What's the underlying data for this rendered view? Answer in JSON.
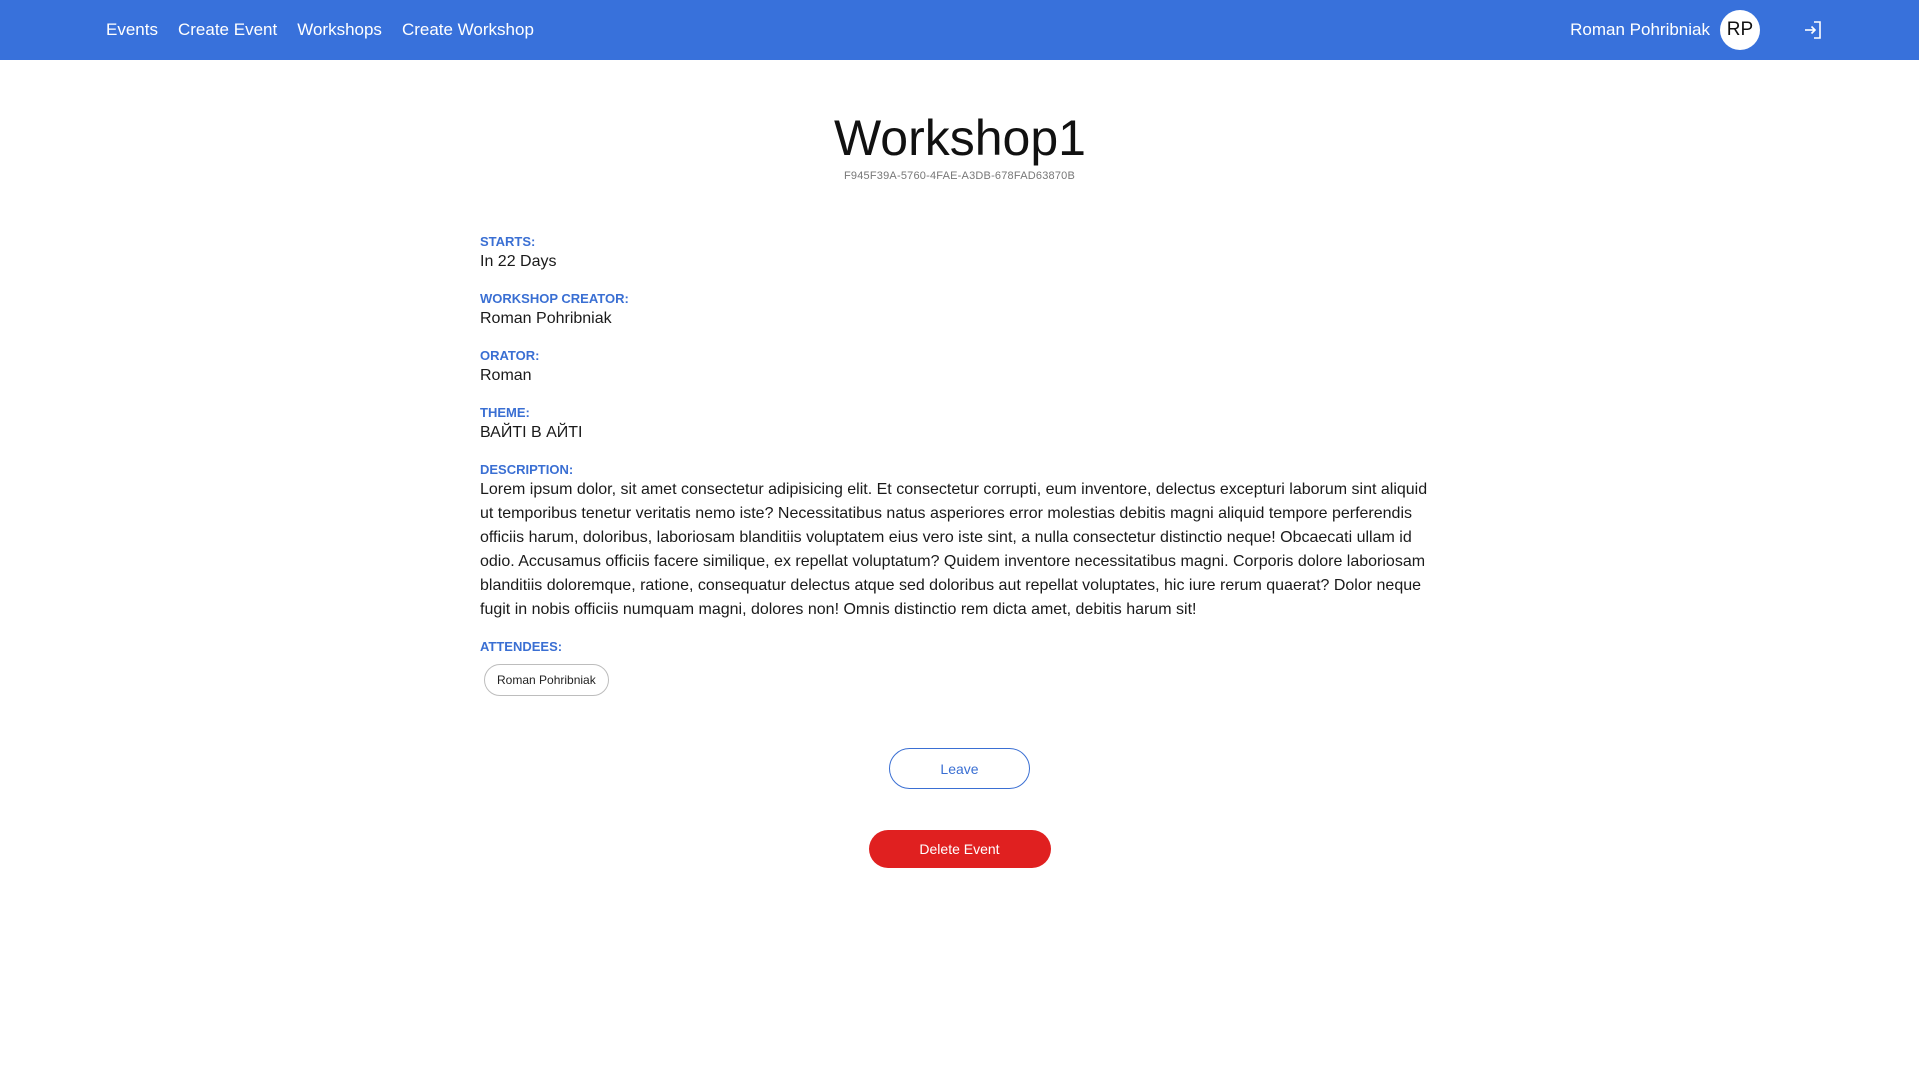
{
  "nav": {
    "links": [
      "Events",
      "Create Event",
      "Workshops",
      "Create Workshop"
    ],
    "user_name": "Roman Pohribniak",
    "avatar_initials": "RP",
    "logout_icon": "logout-icon"
  },
  "workshop": {
    "title": "Workshop1",
    "id": "F945F39A-5760-4FAE-A3DB-678FAD63870B",
    "starts_label": "STARTS:",
    "starts_value": "In 22 Days",
    "creator_label": "WORKSHOP CREATOR:",
    "creator_value": "Roman Pohribniak",
    "orator_label": "ORATOR:",
    "orator_value": "Roman",
    "theme_label": "THEME:",
    "theme_value": "ВАЙТІ В АЙТІ",
    "description_label": "DESCRIPTION:",
    "description_value": "Lorem ipsum dolor, sit amet consectetur adipisicing elit. Et consectetur corrupti, eum inventore, delectus excepturi laborum sint aliquid ut temporibus tenetur veritatis nemo iste? Necessitatibus natus asperiores error molestias debitis magni aliquid tempore perferendis officiis harum, doloribus, laboriosam blanditiis voluptatem eius vero iste sint, a nulla consectetur distinctio neque! Obcaecati ullam id odio. Accusamus officiis facere similique, ex repellat voluptatum? Quidem inventore necessitatibus magni. Corporis dolore laboriosam blanditiis doloremque, ratione, consequatur delectus atque sed doloribus aut repellat voluptates, hic iure rerum quaerat? Dolor neque fugit in nobis officiis numquam magni, dolores non! Omnis distinctio rem dicta amet, debitis harum sit!",
    "attendees_label": "ATTENDEES:",
    "attendees": [
      "Roman Pohribniak"
    ]
  },
  "actions": {
    "leave_label": "Leave",
    "delete_label": "Delete Event"
  },
  "colors": {
    "navbar": "#3871db",
    "accent": "#3a6fd3",
    "danger": "#e02020"
  }
}
